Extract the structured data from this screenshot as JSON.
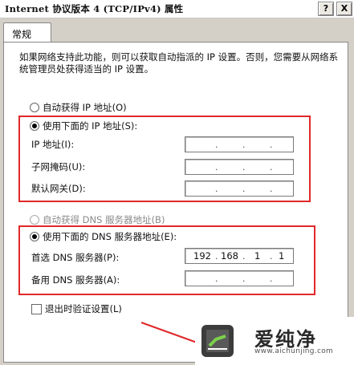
{
  "window": {
    "title": "Internet 协议版本 4 (TCP/IPv4) 属性",
    "help_button": "?",
    "close_button": "X"
  },
  "tabs": [
    {
      "label": "常规",
      "selected": true
    }
  ],
  "description": "如果网络支持此功能，则可以获取自动指派的 IP 设置。否则，您需要从网络系统管理员处获得适当的 IP 设置。",
  "ip_section": {
    "auto_radio": {
      "label": "自动获得 IP 地址(O)",
      "selected": false
    },
    "manual_radio": {
      "label": "使用下面的 IP 地址(S):",
      "selected": true
    },
    "fields": [
      {
        "label": "IP 地址(I):",
        "value": [
          "",
          "",
          "",
          ""
        ]
      },
      {
        "label": "子网掩码(U):",
        "value": [
          "",
          "",
          "",
          ""
        ]
      },
      {
        "label": "默认网关(D):",
        "value": [
          "",
          "",
          "",
          ""
        ]
      }
    ]
  },
  "dns_section": {
    "auto_radio": {
      "label": "自动获得 DNS 服务器地址(B)",
      "selected": false,
      "disabled": true
    },
    "manual_radio": {
      "label": "使用下面的 DNS 服务器地址(E):",
      "selected": true
    },
    "fields": [
      {
        "label": "首选 DNS 服务器(P):",
        "value": [
          "192",
          "168",
          "1",
          "1"
        ]
      },
      {
        "label": "备用 DNS 服务器(A):",
        "value": [
          "",
          "",
          "",
          ""
        ]
      }
    ]
  },
  "validate_checkbox": {
    "label": "退出时验证设置(L)",
    "checked": false
  },
  "watermark": {
    "brand": "爱纯净",
    "url": "www.aichunjing.com"
  },
  "colors": {
    "highlight_box": "#e0282a",
    "dialog_bg": "#d4d0c8"
  }
}
